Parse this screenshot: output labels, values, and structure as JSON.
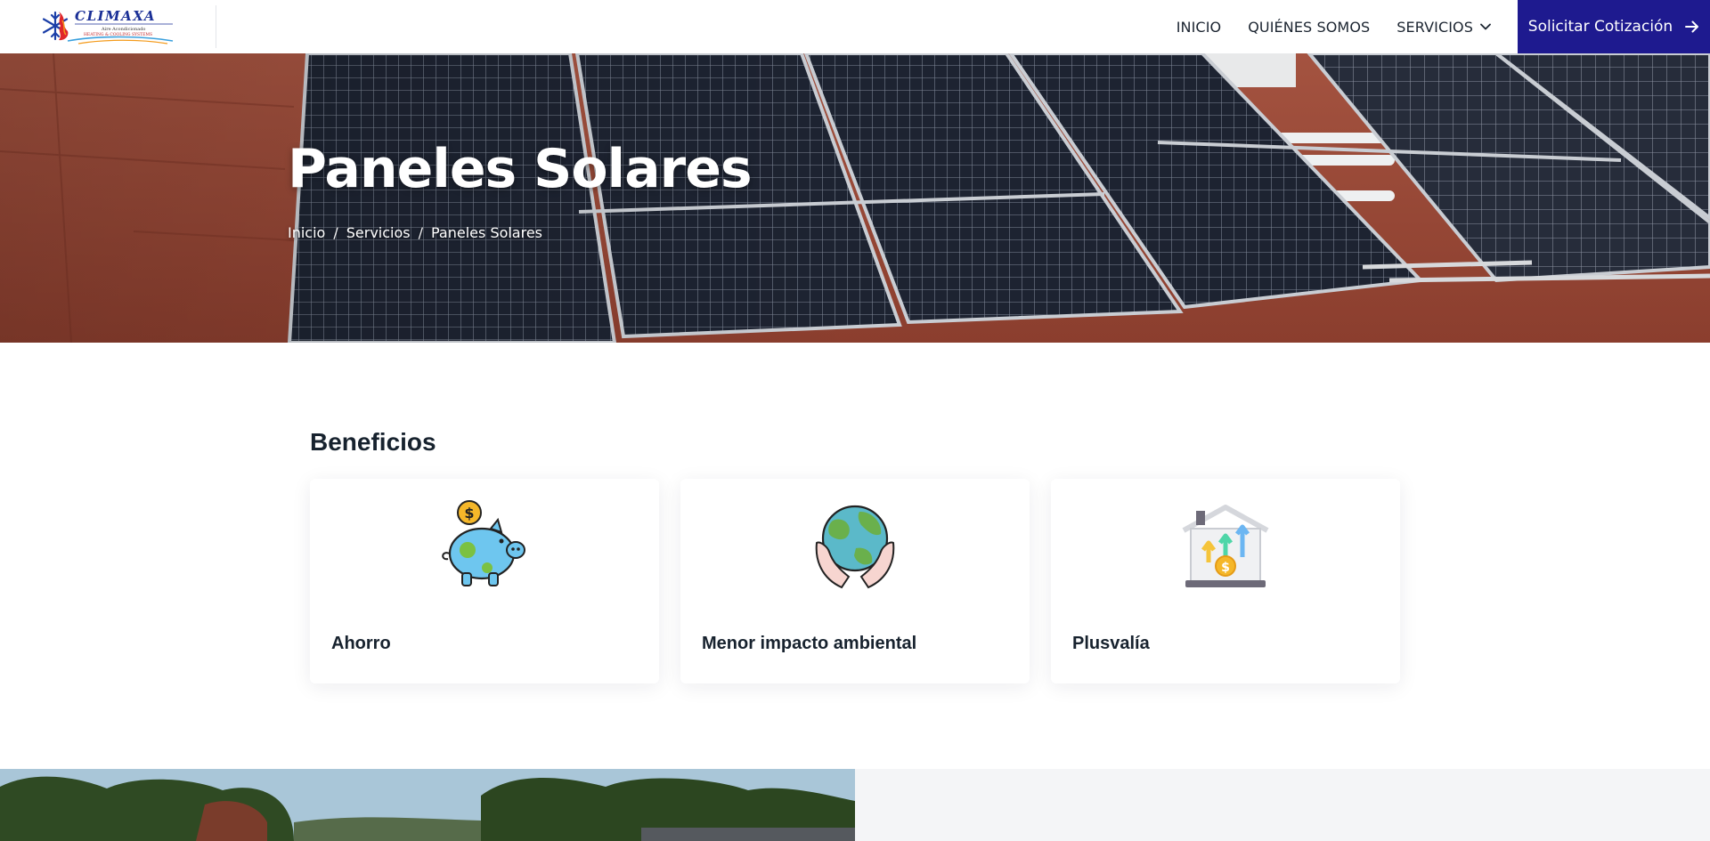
{
  "header": {
    "logo": {
      "brand": "CLIMAXA",
      "tagline": "Aire Acondicionado",
      "subtitle": "HEATING & COOLING SYSTEMS"
    },
    "nav": [
      {
        "label": "INICIO"
      },
      {
        "label": "QUIÉNES SOMOS"
      },
      {
        "label": "SERVICIOS",
        "icon": "chevron-down-icon"
      }
    ],
    "cta": {
      "label": "Solicitar Cotización",
      "icon": "arrow-right-icon"
    }
  },
  "hero": {
    "title": "Paneles Solares",
    "breadcrumb": [
      "Inicio",
      "Servicios",
      "Paneles Solares"
    ],
    "separator": "/"
  },
  "benefits": {
    "title": "Beneficios",
    "cards": [
      {
        "label": "Ahorro",
        "icon": "piggy-bank-icon"
      },
      {
        "label": "Menor impacto ambiental",
        "icon": "globe-in-hands-icon"
      },
      {
        "label": "Plusvalía",
        "icon": "house-value-icon"
      }
    ]
  },
  "colors": {
    "primary": "#1e1a8f",
    "text": "#17222e",
    "roof": "#9c4c3a",
    "panel": "#1c2230"
  }
}
